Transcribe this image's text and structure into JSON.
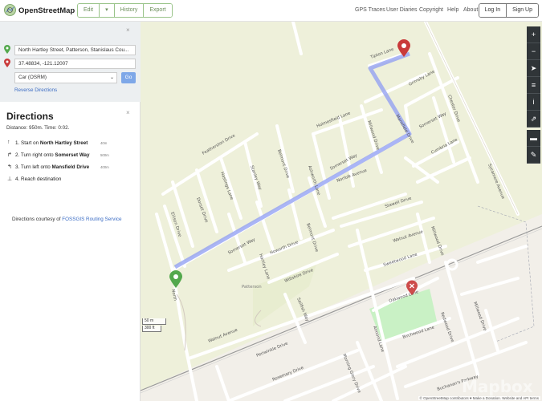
{
  "header": {
    "brand": "OpenStreetMap",
    "edit": "Edit",
    "edit_caret": "▾",
    "history": "History",
    "export": "Export",
    "nav": [
      "GPS Traces",
      "User Diaries",
      "Copyright",
      "Help",
      "About"
    ],
    "login": "Log In",
    "signup": "Sign Up"
  },
  "directions_form": {
    "from_value": "North Hartley Street, Patterson, Stanislaus Cou...",
    "to_value": "37.48834, -121.12007",
    "engine": "Car (OSRM)",
    "go": "Go",
    "reverse": "Reverse Directions",
    "close": "×"
  },
  "results": {
    "title": "Directions",
    "close": "×",
    "summary": "Distance: 950m. Time: 0:02.",
    "steps": [
      {
        "arrow": "↑",
        "num": "1.",
        "pre": "Start on ",
        "street": "North Hartley Street",
        "dist": "40m"
      },
      {
        "arrow": "↱",
        "num": "2.",
        "pre": "Turn right onto ",
        "street": "Somerset Way",
        "dist": "500m"
      },
      {
        "arrow": "↰",
        "num": "3.",
        "pre": "Turn left onto ",
        "street": "Mansfield Drive",
        "dist": "400m"
      },
      {
        "arrow": "⊥",
        "num": "4.",
        "pre": "Reach destination",
        "street": "",
        "dist": ""
      }
    ],
    "courtesy_pre": "Directions courtesy of ",
    "courtesy_link": "FOSSGIS Routing Service"
  },
  "map": {
    "controls": [
      "+",
      "−",
      "➤",
      "≡",
      "i",
      "⇗",
      "▬",
      "✎"
    ],
    "scale_m": "50 m",
    "scale_ft": "300 ft",
    "attribution": "© OpenStreetMap contributors ♥ Make a Donation. Website and API terms",
    "watermark": "Mapbox",
    "streets": {
      "tipton": "Tipton Lane",
      "grimsby": "Grimsby Lane",
      "chester": "Chester Drive",
      "somerset_e": "Somerset Way",
      "cumbria": "Cumbria Lane",
      "mansfield": "Mansfield Drive",
      "holmes": "Holmesfield Lane",
      "sycamore": "Sycamore Avenue",
      "somerset_mid": "Somerset Way",
      "featherston": "Featherston Drive",
      "hastings": "Hastings Lane",
      "stanley": "Stanley Way",
      "belmont_n": "Belmont Drive",
      "ashworth": "Ashworth Lane",
      "norfolk": "Norfolk Avenue",
      "millwood_n": "Millwood Drive",
      "sewell": "Stawell Drive",
      "somerset_w": "Somerset Way",
      "ellison": "Ellison Drive",
      "dorset": "Dorset Drive",
      "howorth": "Howorth Drive",
      "belmont_s": "Belmont Drive",
      "hartley": "Hartley Lane",
      "wiltshire": "Wiltshire Drive",
      "walnut_e": "Walnut Avenue",
      "sweetwood": "Sweetwood Lane",
      "millwood_e": "Millwood Drive",
      "oakwood": "Oakwood Lane",
      "north": "North",
      "patterson": "Patterson",
      "sailfish": "Sailfish Way",
      "walnut_w": "Walnut Avenue",
      "periwinkle": "Periwinkle Drive",
      "morning": "Morning Glory Drive",
      "rosemary": "Rosemary Drive",
      "almond": "Almond Lane",
      "birchwood": "Birchwood Lane",
      "redwood": "Redwood Drive",
      "millwood_s": "Millwood Drive",
      "buchanan": "Buchanan's Parkway"
    }
  }
}
